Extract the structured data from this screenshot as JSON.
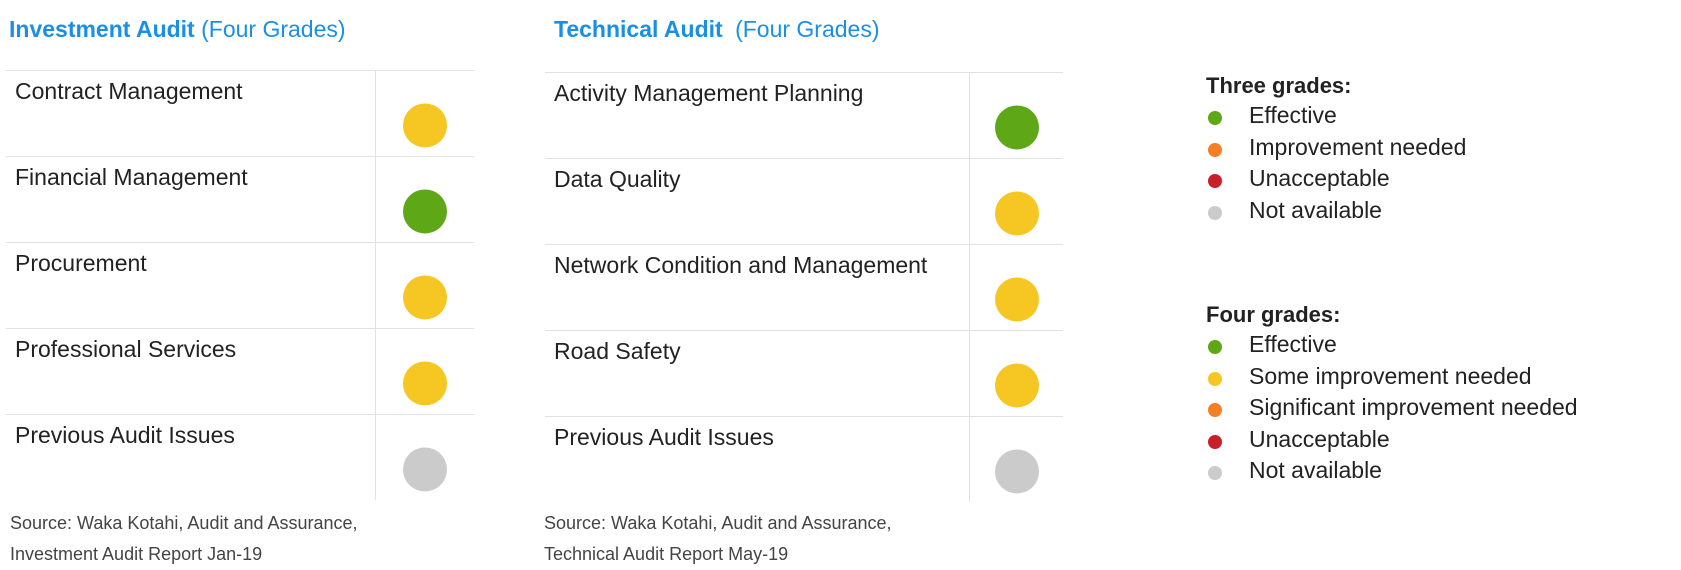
{
  "colors": {
    "green": "#5ea716",
    "yellow": "#f6c722",
    "orange": "#f47f24",
    "red": "#c8202a",
    "grey": "#cbcbcb",
    "accent": "#1a8fe3"
  },
  "investment": {
    "title": "Investment Audit",
    "subtitle": "(Four Grades)",
    "rows": [
      {
        "label": "Contract Management",
        "status": "yellow"
      },
      {
        "label": "Financial Management",
        "status": "green"
      },
      {
        "label": "Procurement",
        "status": "yellow"
      },
      {
        "label": "Professional Services",
        "status": "yellow"
      },
      {
        "label": "Previous Audit Issues",
        "status": "grey"
      }
    ],
    "source_line1": "Source: Waka Kotahi, Audit and Assurance,",
    "source_line2": "Investment Audit Report Jan-19"
  },
  "technical": {
    "title": "Technical Audit",
    "subtitle": "(Four Grades)",
    "rows": [
      {
        "label": "Activity Management Planning",
        "status": "green"
      },
      {
        "label": "Data Quality",
        "status": "yellow"
      },
      {
        "label": "Network Condition and Management",
        "status": "yellow"
      },
      {
        "label": "Road Safety",
        "status": "yellow"
      },
      {
        "label": "Previous Audit Issues",
        "status": "grey"
      }
    ],
    "source_line1": "Source: Waka Kotahi, Audit and Assurance,",
    "source_line2": "Technical Audit Report  May-19"
  },
  "legend": {
    "three": {
      "title": "Three grades:",
      "items": [
        {
          "label": "Effective",
          "status": "green"
        },
        {
          "label": "Improvement needed",
          "status": "orange"
        },
        {
          "label": "Unacceptable",
          "status": "red"
        },
        {
          "label": "Not available",
          "status": "grey"
        }
      ]
    },
    "four": {
      "title": "Four grades:",
      "items": [
        {
          "label": "Effective",
          "status": "green"
        },
        {
          "label": "Some improvement needed",
          "status": "yellow"
        },
        {
          "label": "Significant improvement needed",
          "status": "orange"
        },
        {
          "label": "Unacceptable",
          "status": "red"
        },
        {
          "label": "Not available",
          "status": "grey"
        }
      ]
    }
  }
}
